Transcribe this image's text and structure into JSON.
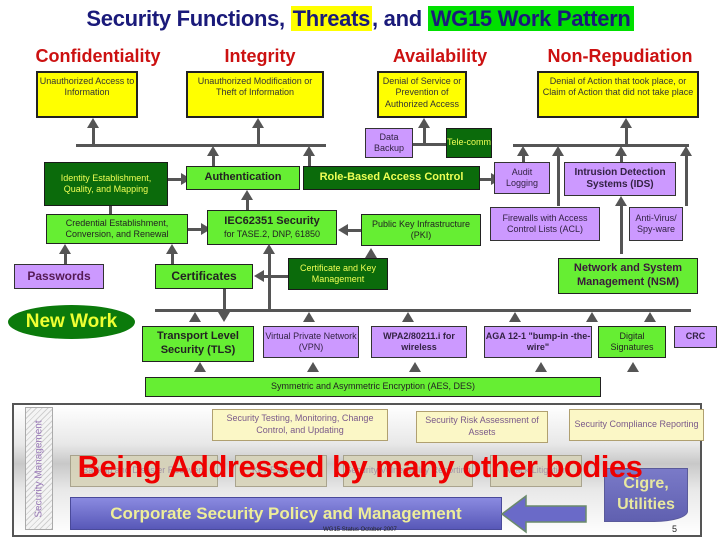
{
  "title": {
    "part1": "Security Functions, ",
    "threats": "Threats",
    "part2": ", and ",
    "wg15": "WG15 Work Pattern"
  },
  "categories": [
    {
      "name": "Confidentiality",
      "threat": "Unauthorized Access to Information"
    },
    {
      "name": "Integrity",
      "threat": "Unauthorized Modification or Theft of Information"
    },
    {
      "name": "Availability",
      "threat": "Denial of Service or Prevention of Authorized Access"
    },
    {
      "name": "Non-Repudiation",
      "threat": "Denial of Action that took place, or Claim of Action that did not take place"
    }
  ],
  "nodes": {
    "data_backup": "Data Backup",
    "telecomm": "Tele-comm",
    "identity": "Identity Establishment, Quality, and Mapping",
    "authentication": "Authentication",
    "rbac": "Role-Based Access Control",
    "audit": "Audit Logging",
    "ids": "Intrusion Detection Systems (IDS)",
    "credential": "Credential Establishment, Conversion, and Renewal",
    "iec_title": "IEC62351 Security",
    "iec_sub": "for TASE.2, DNP, 61850",
    "pki": "Public Key Infrastructure (PKI)",
    "firewalls": "Firewalls with Access Control Lists (ACL)",
    "antivirus": "Anti-Virus/ Spy-ware",
    "passwords": "Passwords",
    "certificates": "Certificates",
    "cert_key_mgmt": "Certificate and Key Management",
    "nsm": "Network and System Management (NSM)",
    "tls": "Transport Level Security (TLS)",
    "vpn": "Virtual Private Network (VPN)",
    "wpa2": "WPA2/80211.i for wireless",
    "aga": "AGA 12-1 \"bump-in -the-wire\"",
    "digital_signatures": "Digital Signatures",
    "crc": "CRC",
    "encryption": "Symmetric and Asymmetric Encryption (AES, DES)"
  },
  "new_work_label": "New Work",
  "management": {
    "side_label": "Security Management",
    "testing": "Security Testing, Monitoring, Change Control, and Updating",
    "risk": "Security Risk Assessment of Assets",
    "compliance": "Security Compliance Reporting",
    "ghost1": "Backup and Disaster Recovery",
    "ghost2": "Key Exchange",
    "ghost3": "Security Vulnerability Reporting",
    "ghost4": "Attack Litigation",
    "policy": "Corporate Security Policy and Management",
    "overlay": "Being Addressed by many other bodies",
    "cigre": "Cigre, Utilities"
  },
  "footer": {
    "status": "WG15 Status October 2007",
    "page": "5"
  }
}
